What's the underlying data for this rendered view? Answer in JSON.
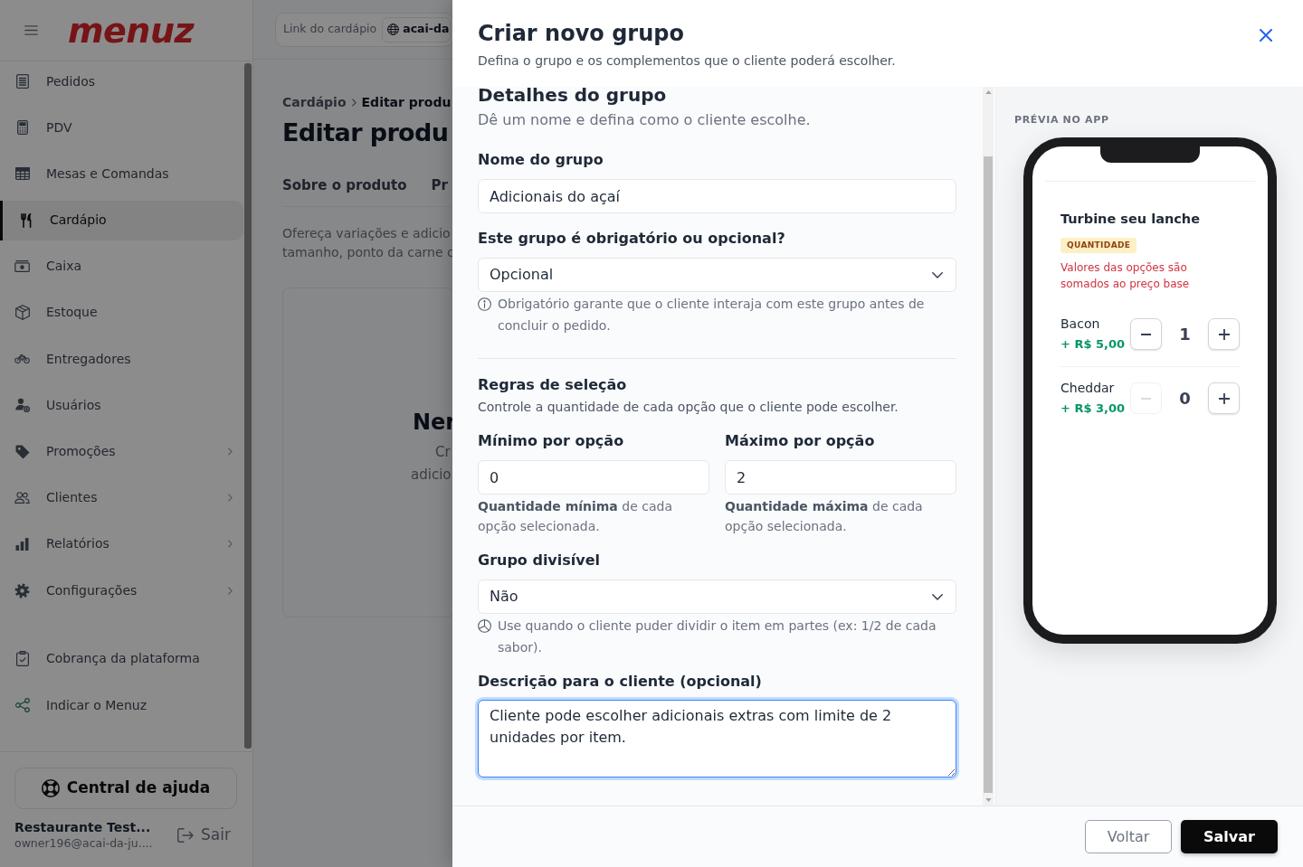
{
  "sidebar": {
    "logo": "menuz",
    "nav_items": [
      {
        "label": "Pedidos",
        "selected": false,
        "has_submenu": false
      },
      {
        "label": "PDV",
        "selected": false,
        "has_submenu": false
      },
      {
        "label": "Mesas e Comandas",
        "selected": false,
        "has_submenu": false
      },
      {
        "label": "Cardápio",
        "selected": true,
        "has_submenu": false
      },
      {
        "label": "Caixa",
        "selected": false,
        "has_submenu": false
      },
      {
        "label": "Estoque",
        "selected": false,
        "has_submenu": false
      },
      {
        "label": "Entregadores",
        "selected": false,
        "has_submenu": false
      },
      {
        "label": "Usuários",
        "selected": false,
        "has_submenu": false
      },
      {
        "label": "Promoções",
        "selected": false,
        "has_submenu": true
      },
      {
        "label": "Clientes",
        "selected": false,
        "has_submenu": true
      },
      {
        "label": "Relatórios",
        "selected": false,
        "has_submenu": true
      },
      {
        "label": "Configurações",
        "selected": false,
        "has_submenu": true
      }
    ],
    "extra_items": [
      {
        "label": "Cobrança da plataforma"
      },
      {
        "label": "Indicar o Menuz"
      }
    ],
    "help_button": "Central de ajuda",
    "account": {
      "name": "Restaurante Test...",
      "email": "owner196@acai-da-ju...."
    },
    "logout_button": "Sair"
  },
  "page": {
    "link_label": "Link do cardápio",
    "link_value": "acai-da",
    "breadcrumb": [
      "Cardápio",
      "Editar produ"
    ],
    "title": "Editar produ",
    "tabs": [
      "Sobre o produto",
      "Pr"
    ],
    "description_lines": [
      "Ofereça variações e adicio",
      "tamanho, ponto da carne c"
    ],
    "empty_state": {
      "title": "Ner",
      "lines": [
        "Cr",
        "adicio"
      ]
    }
  },
  "dialog": {
    "title": "Criar novo grupo",
    "subtitle": "Defina o grupo e os complementos que o cliente poderá escolher.",
    "details": {
      "heading": "Detalhes do grupo",
      "description": "Dê um nome e defina como o cliente escolhe.",
      "name_field": {
        "label": "Nome do grupo",
        "value": "Adicionais do açaí"
      },
      "required_field": {
        "label": "Este grupo é obrigatório ou opcional?",
        "value": "Opcional",
        "hint": "Obrigatório garante que o cliente interaja com este grupo antes de concluir o pedido."
      }
    },
    "rules": {
      "heading": "Regras de seleção",
      "description": "Controle a quantidade de cada opção que o cliente pode escolher.",
      "limits": [
        {
          "label": "Mínimo por opção",
          "value": "0",
          "helper": "**Quantidade mínima** de cada opção selecionada."
        },
        {
          "label": "Máximo por opção",
          "value": "2",
          "helper": "**Quantidade máxima** de cada opção selecionada."
        }
      ],
      "divisible_field": {
        "label": "Grupo divisível",
        "value": "Não",
        "hint": "Use quando o cliente puder dividir o item em partes (ex: 1/2 de cada sabor)."
      },
      "description_field": {
        "label": "Descrição para o cliente (opcional)",
        "value": "Cliente pode escolher adicionais extras com limite de 2 unidades por item.",
        "focused": true
      }
    },
    "preview": {
      "label": "PRÉVIA NO APP",
      "group_title": "Turbine seu lanche",
      "badge": "QUANTIDADE",
      "note": "Valores das opções são somados ao preço base",
      "options": [
        {
          "name": "Bacon",
          "price": "+ R$ 5,00",
          "quantity": "1",
          "minus_disabled": false
        },
        {
          "name": "Cheddar",
          "price": "+ R$ 3,00",
          "quantity": "0",
          "minus_disabled": true
        }
      ]
    },
    "buttons": {
      "back": "Voltar",
      "save": "Salvar"
    }
  }
}
